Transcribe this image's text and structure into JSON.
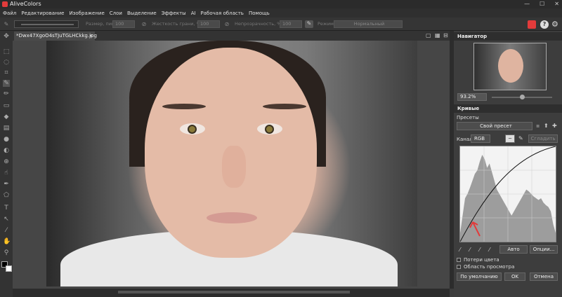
{
  "app": {
    "title": "AliveColors",
    "minimize": "—",
    "maximize": "☐",
    "close": "✕"
  },
  "menu": [
    "Файл",
    "Редактирование",
    "Изображение",
    "Слои",
    "Выделение",
    "Эффекты",
    "AI",
    "Рабочая область",
    "Помощь"
  ],
  "options": {
    "size_label": "Размер, пикс",
    "size_value": "100",
    "hardness_label": "Жесткость грани, %",
    "hardness_value": "100",
    "opacity_label": "Непрозрачность, %",
    "opacity_value": "100",
    "mode_label": "Режим",
    "mode_value": "Нормальный"
  },
  "document": {
    "tab_title": "*Dwx47XgoO4sTJuTGLHCkkg.jpg",
    "tab_close": "✕"
  },
  "navigator": {
    "title": "Навигатор",
    "zoom": "93.2%"
  },
  "curves": {
    "title": "Кривые",
    "presets_label": "Пресеты",
    "preset_value": "Свой пресет",
    "channel_label": "Канал",
    "channel_value": "RGB",
    "smooth_button": "Сгладить",
    "auto_button": "Авто",
    "options_button": "Опции...",
    "color_loss": "Потери цвета",
    "preview_area": "Область просмотра",
    "default_button": "По умолчанию",
    "ok_button": "OK",
    "cancel_button": "Отмена"
  },
  "histogram": [
    0.1,
    0.3,
    0.5,
    0.55,
    0.62,
    0.7,
    0.78,
    0.82,
    0.92,
    1.0,
    0.95,
    0.85,
    0.9,
    0.8,
    0.7,
    0.6,
    0.55,
    0.5,
    0.45,
    0.4,
    0.35,
    0.3,
    0.35,
    0.4,
    0.45,
    0.5,
    0.55,
    0.6,
    0.58,
    0.55,
    0.52,
    0.5,
    0.48,
    0.5,
    0.45,
    0.42,
    0.4,
    0.35,
    0.2,
    0.1
  ],
  "colors": {
    "accent": "#e23b3b",
    "foreground_swatch": "#000000",
    "background_swatch": "#ffffff"
  }
}
